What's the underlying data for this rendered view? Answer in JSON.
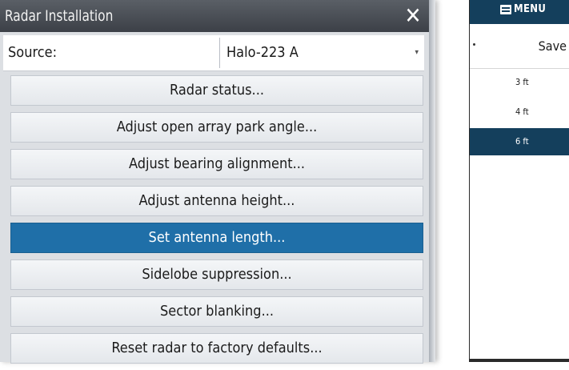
{
  "dialog": {
    "title": "Radar Installation",
    "close_symbol": "✕",
    "source_label": "Source:",
    "source_value": "Halo-223 A",
    "dropdown_arrow": "▾",
    "items": [
      {
        "label": "Radar status..."
      },
      {
        "label": "Adjust open array park angle..."
      },
      {
        "label": "Adjust bearing alignment..."
      },
      {
        "label": "Adjust antenna height..."
      },
      {
        "label": "Set antenna length...",
        "selected": true
      },
      {
        "label": "Sidelobe suppression..."
      },
      {
        "label": "Sector blanking..."
      },
      {
        "label": "Reset radar to factory defaults..."
      }
    ],
    "selected_color": "#1f6fa8"
  },
  "side_menu": {
    "header_label": "MENU",
    "save_label": "Save",
    "options": [
      {
        "label": "3 ft"
      },
      {
        "label": "4 ft"
      },
      {
        "label": "6 ft",
        "selected": true
      }
    ],
    "header_color": "#143f5c"
  }
}
